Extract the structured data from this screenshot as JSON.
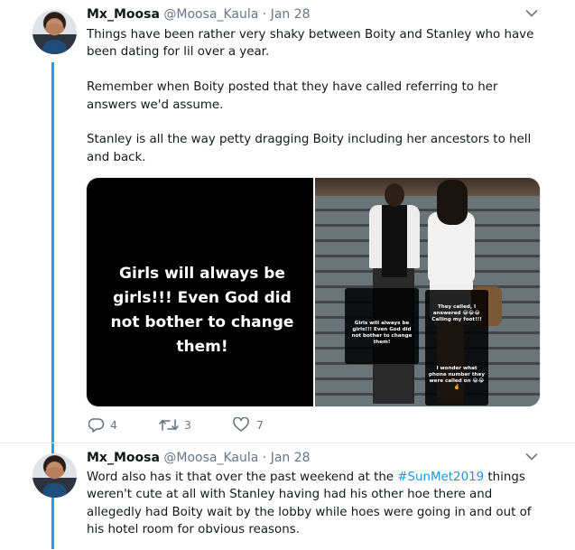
{
  "tweets": [
    {
      "name": "Mx_Moosa",
      "handle": "@Moosa_Kaula",
      "separator": "·",
      "date": "Jan 28",
      "paragraphs": [
        "Things have been rather very shaky between Boity and Stanley who have been dating for lil over a year.",
        "Remember when Boity posted that they have called referring to her answers we'd assume.",
        "Stanley is all the way petty dragging Boity including her ancestors to hell and back."
      ],
      "media": {
        "left_quote": "Girls will always be girls!!! Even God did not bother to change them!",
        "overlay_small_quote": "Girls will always be girls!!! Even God did not bother to change them!",
        "overlay_called": "They called, I answered 😂😂😂 Calling my foot!!!",
        "overlay_phone": "I wonder what phone number they were called on 😂😂🤞"
      },
      "actions": {
        "replies": "4",
        "retweets": "3",
        "likes": "7"
      }
    },
    {
      "name": "Mx_Moosa",
      "handle": "@Moosa_Kaula",
      "separator": "·",
      "date": "Jan 28",
      "text_before": "Word also has it that over the past weekend at the ",
      "hashtag": "#SunMet2019",
      "text_after": " things weren't cute at all with Stanley having had his other hoe there and allegedly had Boity wait by the lobby while hoes were going in and out of his hotel room for obvious reasons."
    }
  ],
  "icons": {
    "more": "chevron-down-icon",
    "reply": "reply-icon",
    "retweet": "retweet-icon",
    "like": "heart-icon"
  },
  "colors": {
    "thread": "#1da1f2",
    "link": "#1b95e0",
    "muted": "#657786"
  }
}
